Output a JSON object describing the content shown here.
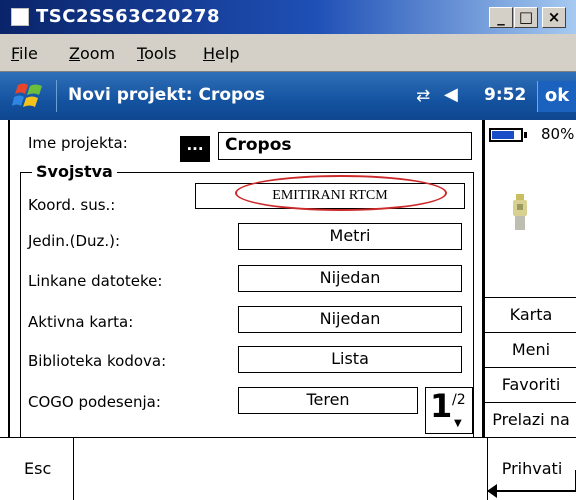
{
  "window": {
    "title": "TSC2SS63C20278",
    "buttons": {
      "minimize": "_",
      "maximize": "□",
      "close": "×"
    }
  },
  "menubar": {
    "items": [
      "File",
      "Zoom",
      "Tools",
      "Help"
    ]
  },
  "status_bar": {
    "title": "Novi projekt: Cropos",
    "time": "9:52",
    "ok_label": "ok",
    "icons": [
      "windows-start-icon",
      "sync-icon",
      "volume-icon"
    ]
  },
  "form": {
    "project_name_label": "Ime projekta:",
    "browse_label": "...",
    "project_name_value": "Cropos",
    "group_title": "Svojstva",
    "rows": [
      {
        "label": "Koord. sus.:",
        "value": "EMITIRANI RTCM"
      },
      {
        "label": "Jedin.(Duz.):",
        "value": "Metri"
      },
      {
        "label": "Linkane datoteke:",
        "value": "Nijedan"
      },
      {
        "label": "Aktivna karta:",
        "value": "Nijedan"
      },
      {
        "label": "Biblioteka kodova:",
        "value": "Lista"
      },
      {
        "label": "COGO podesenja:",
        "value": "Teren"
      }
    ],
    "pager": {
      "current": "1",
      "total": "/2"
    },
    "highlight_color": "#cc2a2a"
  },
  "side_panel": {
    "battery_percent": "80%",
    "battery_level": 0.8,
    "buttons": [
      "Karta",
      "Meni",
      "Favoriti",
      "Prelazi na"
    ]
  },
  "softkeys": {
    "left": "Esc",
    "right": "Prihvati"
  },
  "colors": {
    "status_bar": "#1453a0",
    "title_bar": "#0a246a",
    "accent": "#1b4cc8"
  }
}
